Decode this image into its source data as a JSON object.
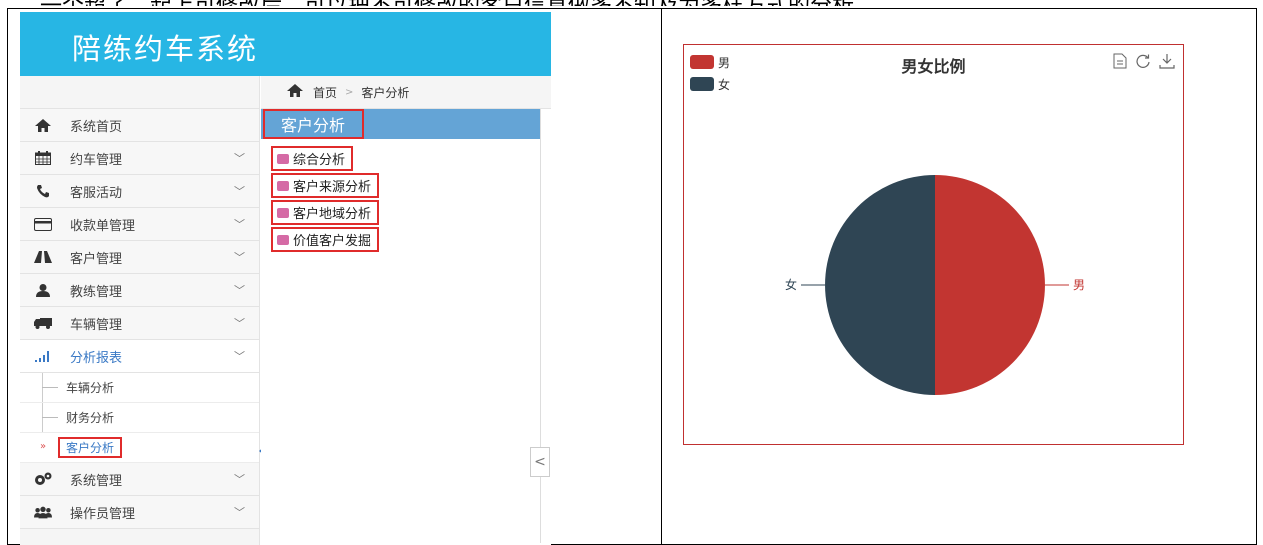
{
  "app": {
    "title": "陪练约车系统",
    "sidebar": {
      "items": [
        {
          "label": "系统首页",
          "icon": "home-icon",
          "chevron": false
        },
        {
          "label": "约车管理",
          "icon": "calendar-icon",
          "chevron": true
        },
        {
          "label": "客服活动",
          "icon": "phone-icon",
          "chevron": true
        },
        {
          "label": "收款单管理",
          "icon": "credit-card-icon",
          "chevron": true
        },
        {
          "label": "客户管理",
          "icon": "road-icon",
          "chevron": true
        },
        {
          "label": "教练管理",
          "icon": "user-icon",
          "chevron": true
        },
        {
          "label": "车辆管理",
          "icon": "truck-icon",
          "chevron": true
        },
        {
          "label": "分析报表",
          "icon": "bar-chart-icon",
          "chevron": true,
          "active": true
        }
      ],
      "subitems": [
        "车辆分析",
        "财务分析",
        "客户分析"
      ],
      "bottom_items": [
        {
          "label": "系统管理",
          "icon": "gears-icon"
        },
        {
          "label": "操作员管理",
          "icon": "users-icon"
        }
      ],
      "chevron_glyph": "﹀",
      "current_marker": "»"
    },
    "breadcrumb": {
      "home": "首页",
      "separator": ">",
      "current": "客户分析"
    },
    "panel": {
      "title": "客户分析",
      "items": [
        "综合分析",
        "客户来源分析",
        "客户地域分析",
        "价值客户发掘"
      ]
    },
    "collapse_glyph": "<"
  },
  "chart_data": {
    "type": "pie",
    "title": "男女比例",
    "legend": [
      "男",
      "女"
    ],
    "legend_position": "top-left",
    "slices": [
      {
        "name": "男",
        "value": 50,
        "color": "#c23531"
      },
      {
        "name": "女",
        "value": 50,
        "color": "#2f4554"
      }
    ],
    "toolbox": [
      "data-view-icon",
      "restore-icon",
      "save-image-icon"
    ]
  }
}
